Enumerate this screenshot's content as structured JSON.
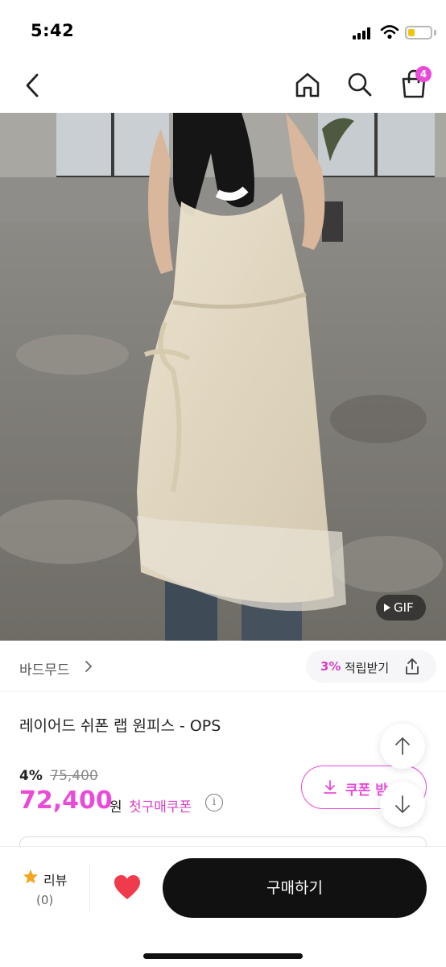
{
  "status_bar": {
    "time": "5:42",
    "icons": [
      "signal-icon",
      "wifi-icon",
      "battery-icon"
    ],
    "battery_color": "#f4c20d"
  },
  "nav": {
    "icons": [
      "back-arrow-icon",
      "home-icon",
      "search-icon",
      "cart-icon"
    ],
    "cart_badge": "4"
  },
  "product_image": {
    "description_icon": "product-photo",
    "gif_label": "GIF"
  },
  "brand": {
    "name": "바드무드",
    "points_percent": "3%",
    "points_label": "적립받기"
  },
  "product": {
    "title": "레이어드 쉬폰 랩 원피스 - OPS",
    "discount_percent": "4%",
    "original_price": "75,400",
    "sale_price": "72,400",
    "currency": "원",
    "first_coupon_label": "첫구매쿠폰",
    "coupon_button_label": "쿠폰 받"
  },
  "bottom_bar": {
    "review_label": "리뷰",
    "review_count": "(0)",
    "buy_label": "구매하기"
  },
  "colors": {
    "accent": "#e94bd8",
    "heart": "#ef3b4b",
    "star": "#f4a623",
    "buy_button": "#111111"
  }
}
